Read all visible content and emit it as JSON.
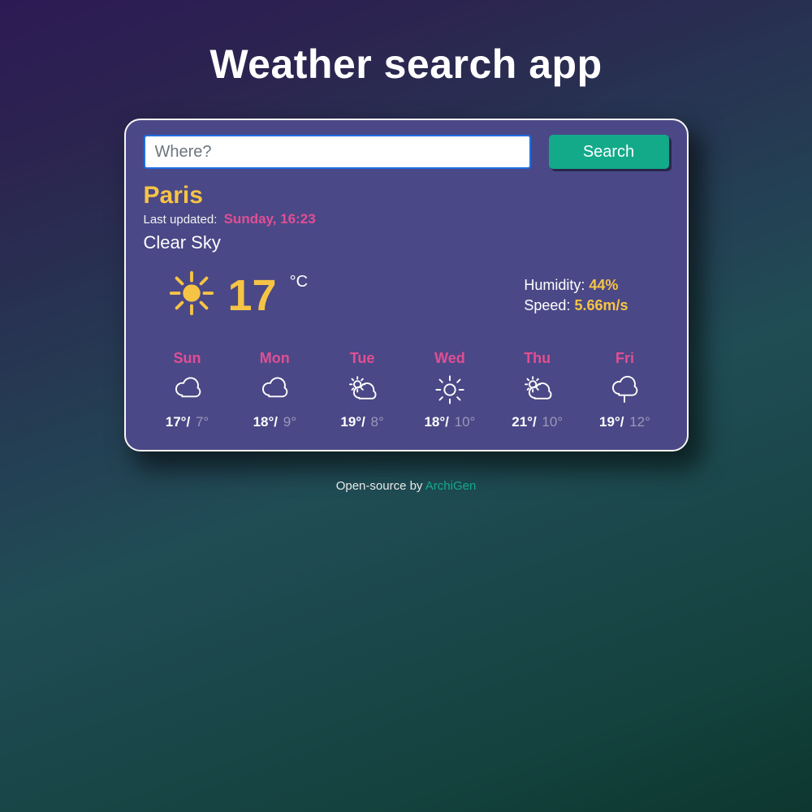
{
  "header": {
    "title": "Weather search app"
  },
  "search": {
    "placeholder": "Where?",
    "button": "Search"
  },
  "current": {
    "city": "Paris",
    "updated_label": "Last updated:",
    "updated_time": "Sunday, 16:23",
    "condition": "Clear Sky",
    "temperature": "17",
    "unit": "°C",
    "humidity_label": "Humidity:",
    "humidity_value": "44%",
    "wind_label": "Speed:",
    "wind_value": "5.66m/s"
  },
  "forecast": [
    {
      "day": "Sun",
      "icon": "cloud",
      "hi": "17°",
      "lo": "7°"
    },
    {
      "day": "Mon",
      "icon": "cloud",
      "hi": "18°",
      "lo": "9°"
    },
    {
      "day": "Tue",
      "icon": "partly",
      "hi": "19°",
      "lo": "8°"
    },
    {
      "day": "Wed",
      "icon": "sun",
      "hi": "18°",
      "lo": "10°"
    },
    {
      "day": "Thu",
      "icon": "partly",
      "hi": "21°",
      "lo": "10°"
    },
    {
      "day": "Fri",
      "icon": "rain",
      "hi": "19°",
      "lo": "12°"
    }
  ],
  "footer": {
    "prefix": "Open-source by ",
    "author": "ArchiGen"
  }
}
